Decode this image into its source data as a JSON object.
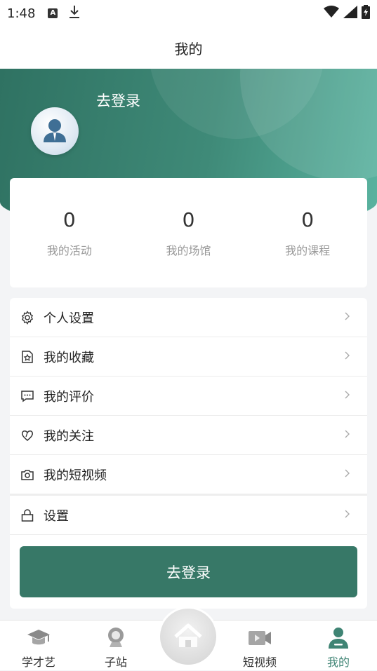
{
  "status_bar": {
    "time": "1:48",
    "icons": [
      "a-notification-icon",
      "download-icon",
      "wifi-icon",
      "signal-icon",
      "battery-icon"
    ]
  },
  "header": {
    "title": "我的"
  },
  "profile": {
    "login_prompt": "去登录"
  },
  "stats": [
    {
      "value": "0",
      "label": "我的活动"
    },
    {
      "value": "0",
      "label": "我的场馆"
    },
    {
      "value": "0",
      "label": "我的课程"
    }
  ],
  "menu": {
    "items": [
      {
        "label": "个人设置",
        "icon": "gear-icon"
      },
      {
        "label": "我的收藏",
        "icon": "favorite-star-icon"
      },
      {
        "label": "我的评价",
        "icon": "comment-icon"
      },
      {
        "label": "我的关注",
        "icon": "heart-outline-icon"
      },
      {
        "label": "我的短视频",
        "icon": "camera-icon"
      },
      {
        "label": "设置",
        "icon": "lock-icon"
      }
    ],
    "login_button": "去登录"
  },
  "tabbar": {
    "items": [
      {
        "label": "学才艺",
        "icon": "graduation-cap-icon",
        "active": false
      },
      {
        "label": "子站",
        "icon": "location-pin-icon",
        "active": false
      },
      {
        "label": "",
        "icon": "home-icon",
        "active": false
      },
      {
        "label": "短视频",
        "icon": "video-icon",
        "active": false
      },
      {
        "label": "我的",
        "icon": "user-icon",
        "active": true
      }
    ]
  },
  "colors": {
    "primary": "#377867",
    "hero_start": "#2f7262",
    "hero_end": "#5ab3a0",
    "active_tab": "#3f8474"
  }
}
